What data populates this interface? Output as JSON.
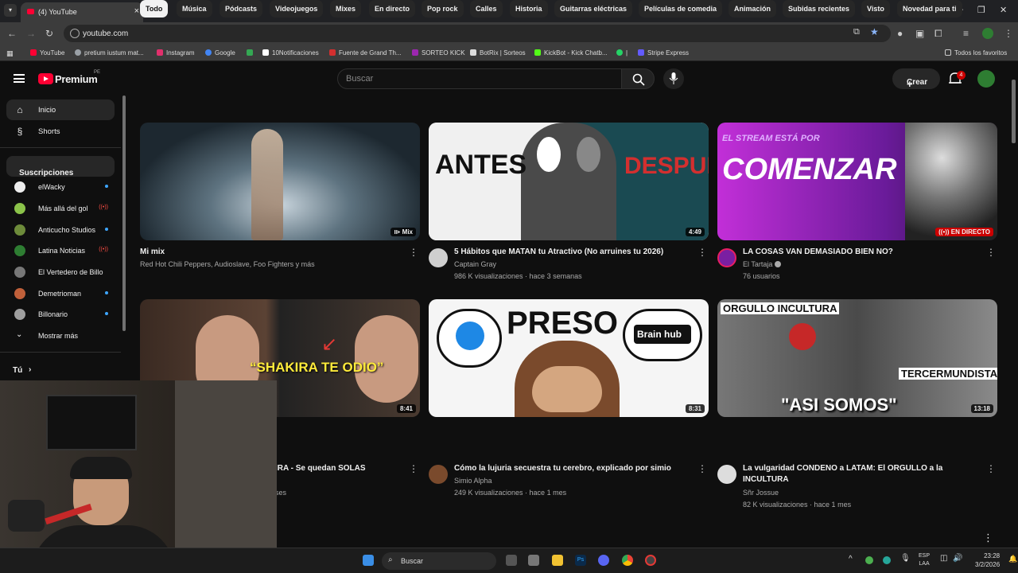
{
  "browser": {
    "tab_title": "(4) YouTube",
    "url": "youtube.com",
    "bookmarks": [
      {
        "label": "YouTube",
        "color": "#ff0033"
      },
      {
        "label": "pretium iustum mat...",
        "color": "#9aa0a6"
      },
      {
        "label": "Instagram",
        "color": "#e1306c"
      },
      {
        "label": "Google",
        "color": "#4285f4"
      },
      {
        "label": "",
        "color": "#34a853"
      },
      {
        "label": "10Notificaciones",
        "color": "#ffffff"
      },
      {
        "label": "Fuente de Grand Th...",
        "color": "#d32f2f"
      },
      {
        "label": "SORTEO KICK",
        "color": "#9c27b0"
      },
      {
        "label": "BotRix | Sorteos",
        "color": "#dddddd"
      },
      {
        "label": "KickBot - Kick Chatb...",
        "color": "#53fc18"
      },
      {
        "label": "|",
        "color": "#25d366"
      },
      {
        "label": "Stripe Express",
        "color": "#635bff"
      }
    ],
    "all_favorites": "Todos los favoritos"
  },
  "header": {
    "logo_text": "Premium",
    "logo_region": "PE",
    "search_placeholder": "Buscar",
    "create_label": "Crear",
    "notif_count": "4"
  },
  "sidebar": {
    "items": [
      {
        "label": "Inicio",
        "icon": "home-icon",
        "glyph": "⌂"
      },
      {
        "label": "Shorts",
        "icon": "shorts-icon",
        "glyph": "§"
      }
    ],
    "subs_heading": "Suscripciones",
    "subscriptions": [
      {
        "label": "elWacky",
        "color": "#eeeeee",
        "status": "new"
      },
      {
        "label": "Más allá del gol",
        "color": "#8bc34a",
        "status": "live"
      },
      {
        "label": "Anticucho Studios",
        "color": "#6d8b3a",
        "status": "new"
      },
      {
        "label": "Latina Noticias",
        "color": "#2e7d32",
        "status": "live"
      },
      {
        "label": "El Vertedero de Billo",
        "color": "#777777",
        "status": "none"
      },
      {
        "label": "Demetrioman",
        "color": "#c0603a",
        "status": "new"
      },
      {
        "label": "Billonario",
        "color": "#9e9e9e",
        "status": "new"
      }
    ],
    "show_more": "Mostrar más",
    "you_heading": "Tú"
  },
  "chips": [
    "Todo",
    "Música",
    "Pódcasts",
    "Videojuegos",
    "Mixes",
    "En directo",
    "Pop rock",
    "Calles",
    "Historia",
    "Guitarras eléctricas",
    "Películas de comedia",
    "Animación",
    "Subidas recientes",
    "Visto",
    "Novedad para ti"
  ],
  "videos": [
    {
      "title": "Mi mix",
      "title2": "",
      "channel": "Red Hot Chili Peppers, Audioslave, Foo Fighters y más",
      "stats": "",
      "duration": "Mix",
      "thumb_text": "",
      "bg": "#3a4a58"
    },
    {
      "title": "5 Hábitos que MATAN tu Atractivo (No arruines tu 2026)",
      "title2": "",
      "channel": "Captain Gray",
      "stats": "986 K visualizaciones · hace 3 semanas",
      "duration": "4:49",
      "thumb_text": "ANTES",
      "thumb_text2": "DESPUES",
      "bg": "#e8e8e8"
    },
    {
      "title": "LA COSAS VAN DEMASIADO BIEN NO?",
      "title2": "",
      "channel": "El Tartaja",
      "stats": "76 usuarios",
      "duration": "EN DIRECTO",
      "thumb_text": "COMENZAR",
      "thumb_text2": "EL STREAM ESTÁ POR",
      "bg": "#7a1fa2"
    },
    {
      "title": "IRA - Se quedan SOLAS",
      "title2": "",
      "channel": "",
      "stats": "ses",
      "duration": "8:41",
      "thumb_text": "“SHAKIRA TE ODIO”",
      "bg": "#2b2b2b"
    },
    {
      "title": "Cómo la lujuria secuestra tu cerebro, explicado por simio",
      "title2": "",
      "channel": "Simio Alpha",
      "stats": "249 K visualizaciones · hace 1 mes",
      "duration": "8:31",
      "thumb_text": "PRESO",
      "thumb_text2": "Brain hub",
      "bg": "#f5f5f5"
    },
    {
      "title": "La vulgaridad CONDENO a LATAM: El ORGULLO a la",
      "title2": "INCULTURA",
      "channel": "Sñr Jossue",
      "stats": "82 K visualizaciones · hace 1 mes",
      "duration": "13:18",
      "thumb_text": "ORGULLO INCULTURA",
      "thumb_text2": "TERCERMUNDISTA",
      "thumb_text3": "\"ASI SOMOS\"",
      "bg": "#5a5a5a"
    }
  ],
  "taskbar": {
    "search": "Buscar",
    "lang1": "ESP",
    "lang2": "LAA",
    "time": "23:28",
    "date": "3/2/2026"
  }
}
